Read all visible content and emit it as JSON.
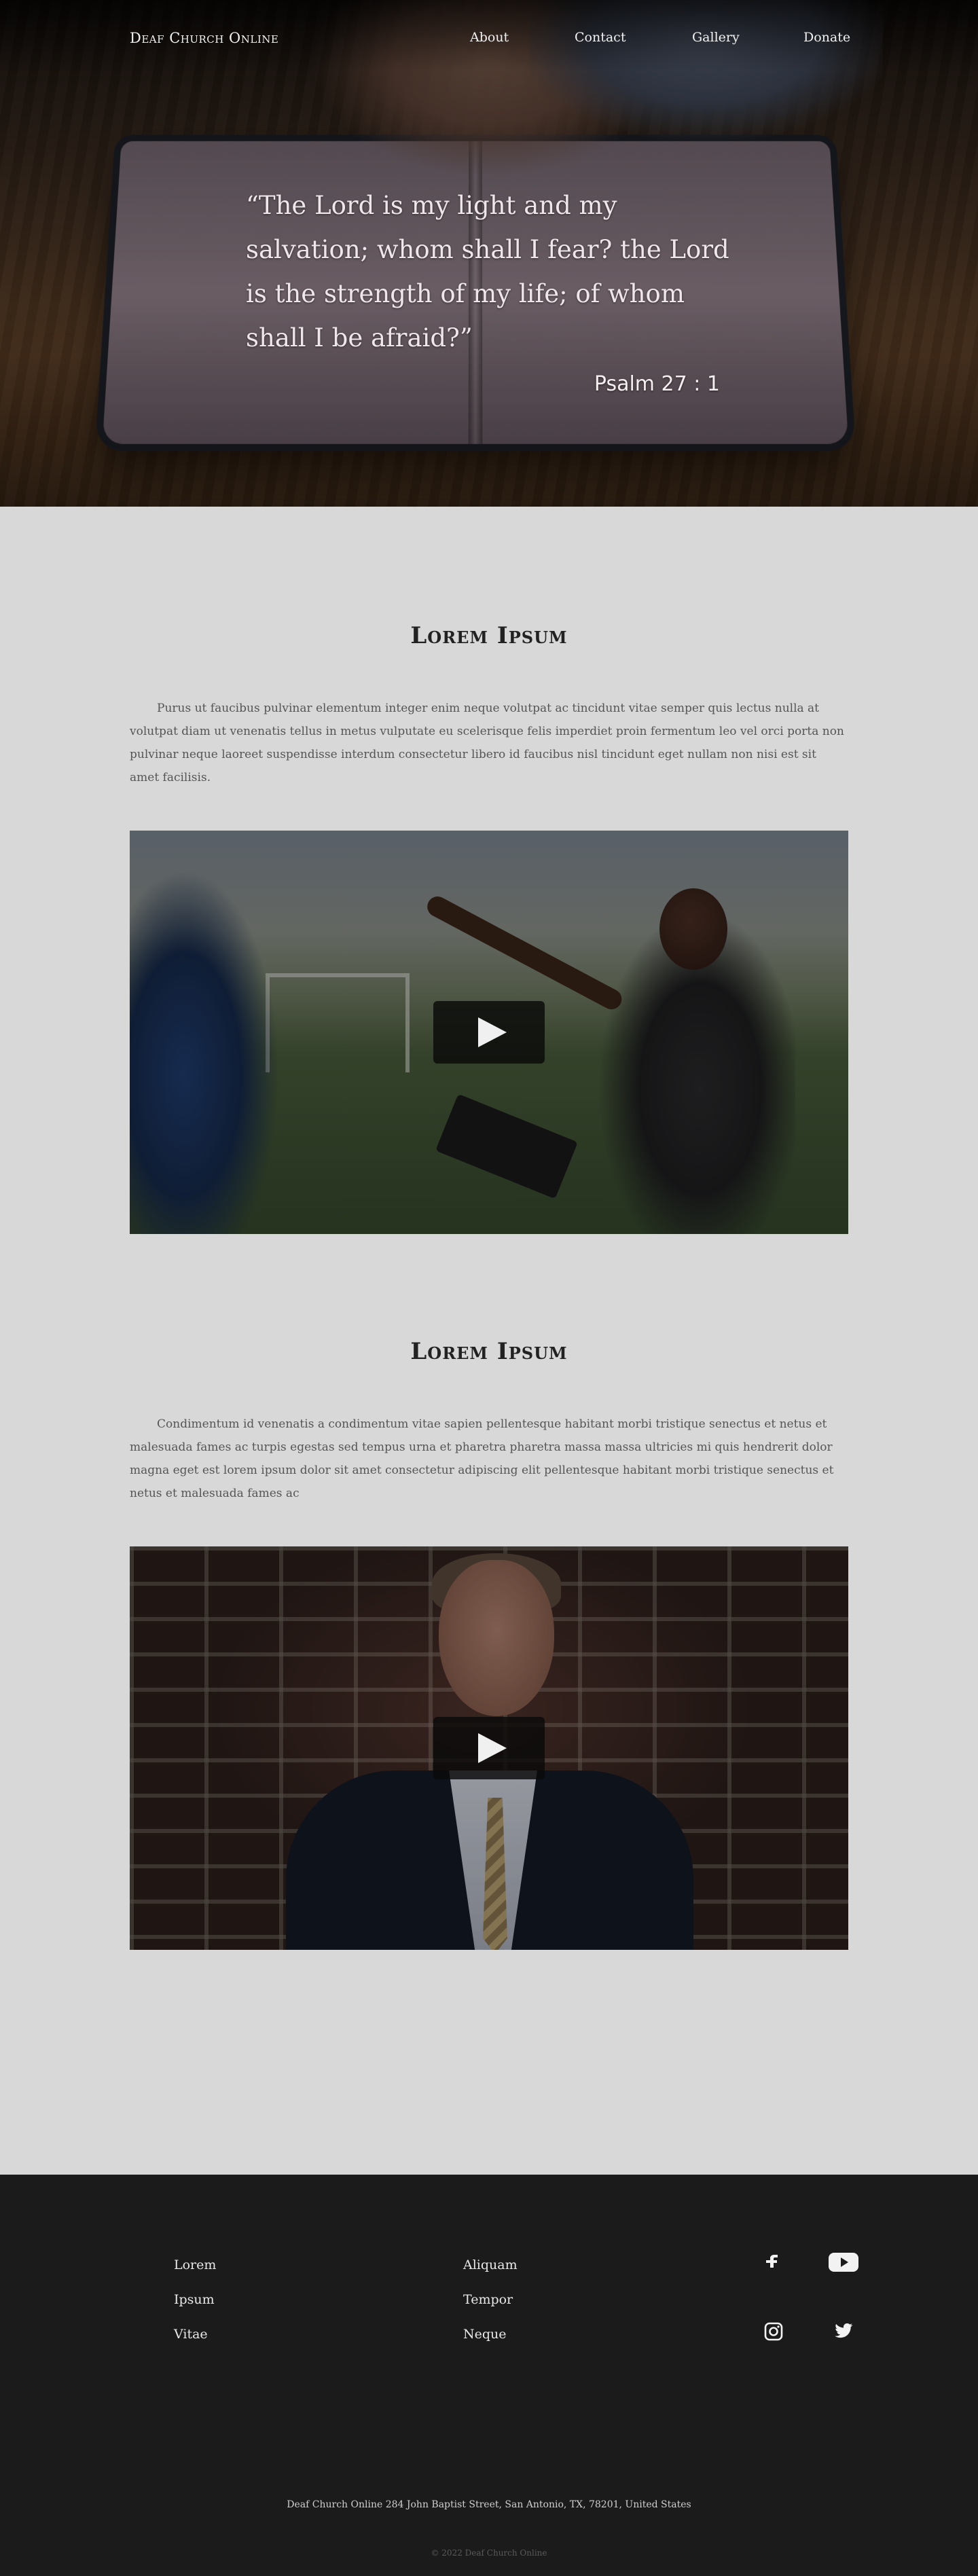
{
  "header": {
    "brand": "Deaf Church Online",
    "nav": [
      "About",
      "Contact",
      "Gallery",
      "Donate"
    ]
  },
  "hero": {
    "quote": "“The Lord is my light and my salvation; whom shall I fear? the Lord is the strength of my life; of whom shall I be afraid?”",
    "citation": "Psalm 27 : 1"
  },
  "sections": [
    {
      "title": "Lorem Ipsum",
      "body": "Purus ut faucibus pulvinar elementum integer enim neque volutpat ac tincidunt vitae semper quis lectus nulla at volutpat diam ut venenatis tellus in metus vulputate eu scelerisque felis imperdiet proin fermentum leo vel orci porta non pulvinar neque laoreet suspendisse interdum consectetur libero id faucibus nisl tincidunt eget nullam non nisi est sit amet facilisis."
    },
    {
      "title": "Lorem Ipsum",
      "body": "Condimentum id venenatis a condimentum vitae sapien pellentesque habitant morbi tristique senectus et netus et malesuada fames ac turpis egestas sed tempus urna et pharetra pharetra massa massa ultricies mi quis hendrerit dolor magna eget est lorem ipsum dolor sit amet consectetur adipiscing elit pellentesque habitant morbi tristique senectus et netus et malesuada fames ac"
    }
  ],
  "footer": {
    "col1": [
      "Lorem",
      "Ipsum",
      "Vitae"
    ],
    "col2": [
      "Aliquam",
      "Tempor",
      "Neque"
    ],
    "social_icons": [
      "facebook-icon",
      "youtube-icon",
      "instagram-icon",
      "twitter-icon"
    ],
    "address": "Deaf Church Online 284 John Baptist Street, San Antonio, TX, 78201, United States",
    "copyright": "© 2022 Deaf Church Online"
  },
  "colors": {
    "page_bg": "#d8d8d8",
    "footer_bg": "#1b1b1b",
    "text_dark": "#222222",
    "text_muted": "#555555"
  }
}
